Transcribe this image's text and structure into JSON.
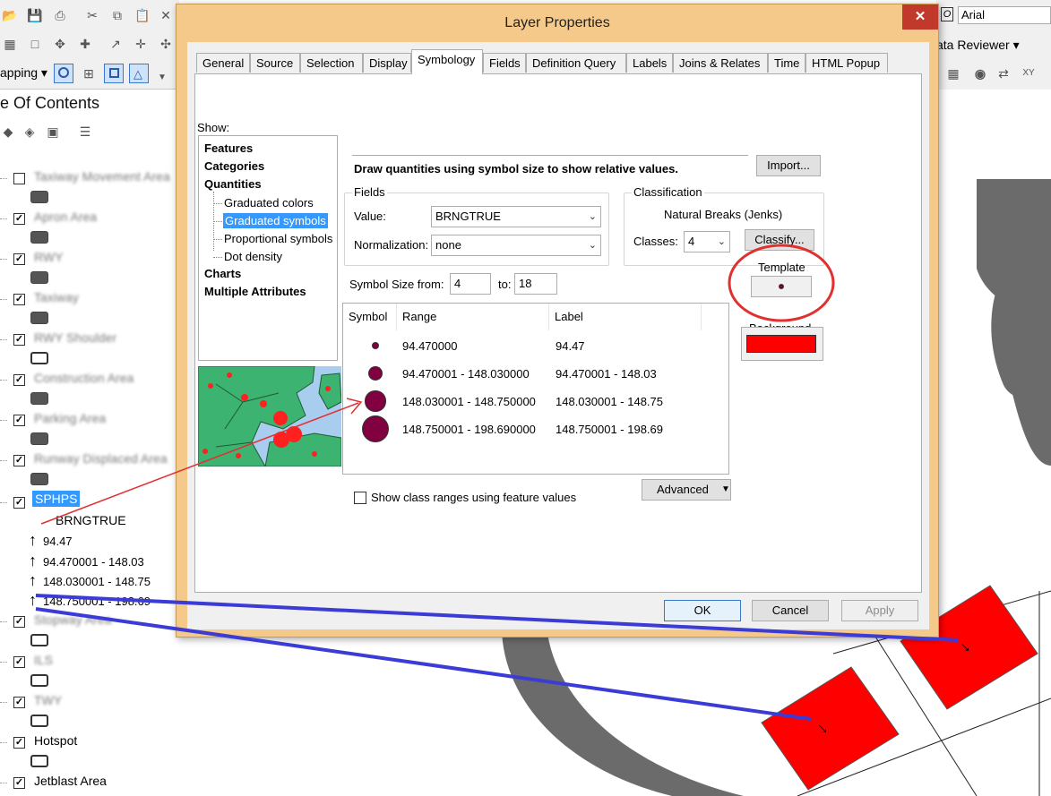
{
  "toolbar": {
    "mapping_label": "apping ▾",
    "right_font": "Arial",
    "data_reviewer": "ata Reviewer ▾"
  },
  "toc": {
    "title": "e Of Contents",
    "layers": [
      {
        "name": "Taxiway Movement Area",
        "checked": false,
        "blurred": true,
        "swatch": "filled"
      },
      {
        "name": "Apron Area",
        "checked": true,
        "blurred": true,
        "swatch": "filled"
      },
      {
        "name": "RWY",
        "checked": true,
        "blurred": true,
        "swatch": "filled"
      },
      {
        "name": "Taxiway",
        "checked": true,
        "blurred": true,
        "swatch": "filled"
      },
      {
        "name": "RWY Shoulder",
        "checked": true,
        "blurred": true,
        "swatch": "hollow"
      },
      {
        "name": "Construction Area",
        "checked": true,
        "blurred": true,
        "swatch": "filled"
      },
      {
        "name": "Parking Area",
        "checked": true,
        "blurred": true,
        "swatch": "filled"
      },
      {
        "name": "Runway Displaced Area",
        "checked": true,
        "blurred": true,
        "swatch": "filled"
      }
    ],
    "sphps": {
      "name": "SPHPS",
      "field": "BRNGTRUE",
      "legend": [
        "94.47",
        "94.470001 - 148.03",
        "148.030001 - 148.75",
        "148.750001 - 198.69"
      ]
    },
    "layers_below": [
      {
        "name": "Stopway Area",
        "checked": true,
        "blurred": true,
        "swatch": "hollow"
      },
      {
        "name": "ILS",
        "checked": true,
        "blurred": true,
        "swatch": "hollow"
      },
      {
        "name": "TWY",
        "checked": true,
        "blurred": true,
        "swatch": "hollow"
      },
      {
        "name": "Hotspot",
        "checked": true,
        "blurred": false,
        "swatch": "hollow"
      },
      {
        "name": "Jetblast Area",
        "checked": true,
        "blurred": false,
        "swatch": "none"
      }
    ]
  },
  "dialog": {
    "title": "Layer Properties",
    "close_glyph": "✕",
    "tabs": [
      "General",
      "Source",
      "Selection",
      "Display",
      "Symbology",
      "Fields",
      "Definition Query",
      "Labels",
      "Joins & Relates",
      "Time",
      "HTML Popup"
    ],
    "active_tab": "Symbology",
    "show_label": "Show:",
    "show_tree": {
      "features": "Features",
      "categories": "Categories",
      "quantities": "Quantities",
      "quantity_children": [
        "Graduated colors",
        "Graduated symbols",
        "Proportional symbols",
        "Dot density"
      ],
      "selected_child": "Graduated symbols",
      "charts": "Charts",
      "multiple": "Multiple Attributes"
    },
    "description": "Draw quantities using symbol size to show relative values.",
    "import_button": "Import...",
    "fields": {
      "group_label": "Fields",
      "value_label": "Value:",
      "value": "BRNGTRUE",
      "normalization_label": "Normalization:",
      "normalization": "none"
    },
    "classification": {
      "group_label": "Classification",
      "method": "Natural Breaks (Jenks)",
      "classes_label": "Classes:",
      "classes": "4",
      "classify_button": "Classify..."
    },
    "symbol_size": {
      "from_label": "Symbol Size from:",
      "from": "4",
      "to_label": "to:",
      "to": "18"
    },
    "table": {
      "headers": [
        "Symbol",
        "Range",
        "Label"
      ],
      "rows": [
        {
          "range": "94.470000",
          "label": "94.47",
          "size": 4
        },
        {
          "range": "94.470001 - 148.030000",
          "label": "94.470001 - 148.03",
          "size": 8.7
        },
        {
          "range": "148.030001 - 148.750000",
          "label": "148.030001 - 148.75",
          "size": 13.3
        },
        {
          "range": "148.750001 - 198.690000",
          "label": "148.750001 - 198.69",
          "size": 18
        }
      ]
    },
    "template_label": "Template",
    "background_label": "Background",
    "background_color": "#ff0000",
    "symbol_color": "#800040",
    "show_class_ranges": "Show class ranges using feature values",
    "advanced_button": "Advanced",
    "ok": "OK",
    "cancel": "Cancel",
    "apply": "Apply"
  },
  "colors": {
    "dialog_frame": "#f5c98a",
    "close_red": "#c0392b",
    "selection_blue": "#3399ff",
    "annotation_red": "#e03030",
    "annotation_blue": "#3b3bd6"
  }
}
